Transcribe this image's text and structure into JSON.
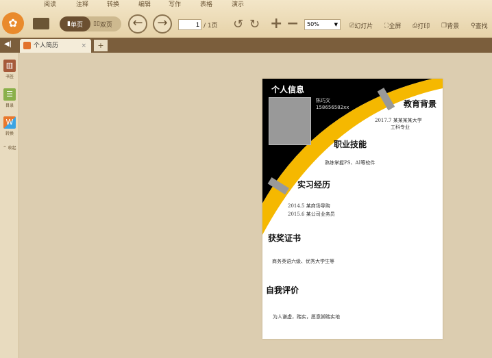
{
  "menu_tabs": [
    "阅读",
    "注释",
    "转换",
    "编辑",
    "写作",
    "表格",
    "演示"
  ],
  "toolbar": {
    "single_page": "单页",
    "double_page": "双页",
    "page_input": "1",
    "page_total": "/ 1页",
    "zoom": "50%",
    "slideshow": "幻灯片",
    "fullscreen": "全屏",
    "print": "打印",
    "background": "背景",
    "search": "查找"
  },
  "doc_tab": {
    "title": "个人简历",
    "close": "×",
    "new": "+"
  },
  "sidebar": {
    "bookmark": "书签",
    "toc": "目录",
    "convert": "转换",
    "collapse": "^ 收起"
  },
  "resume": {
    "info_title": "个人信息",
    "name": "陈巧文",
    "phone": "158656582xx",
    "edu_title": "教育背景",
    "edu_line1": "2017.7 某某某某大学",
    "edu_line2": "工科专业",
    "skill_title": "职业技能",
    "skill_text": "熟练掌握PS、AI等软件",
    "intern_title": "实习经历",
    "intern_line1": "2014.5 某商场导购",
    "intern_line2": "2015.6 某公司业务员",
    "award_title": "获奖证书",
    "award_text": "商务英语六级、优秀大学生等",
    "self_title": "自我评价",
    "self_text": "为人谦虚，踏实，愿意脚踏实地"
  },
  "colors": {
    "accent": "#f5b800",
    "dark": "#000000",
    "tabbar": "#7b5e3c"
  }
}
